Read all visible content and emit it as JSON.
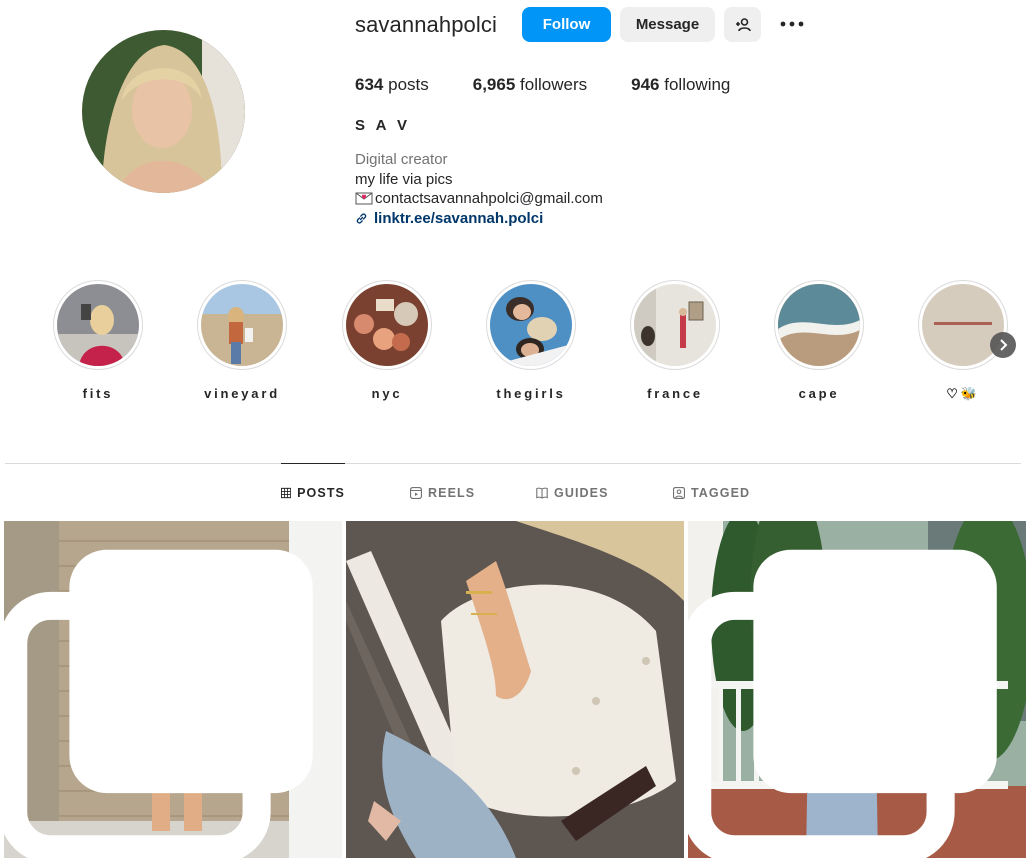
{
  "profile": {
    "username": "savannahpolci",
    "follow_label": "Follow",
    "message_label": "Message",
    "add_user_icon": "person-add-icon",
    "more_icon": "more-dots-icon",
    "posts_count": "634",
    "posts_label": "posts",
    "followers_count": "6,965",
    "followers_label": "followers",
    "following_count": "946",
    "following_label": "following",
    "full_name": "S A V",
    "category": "Digital creator",
    "bio_line": "my life via pics",
    "email": "contactsavannahpolci@gmail.com",
    "link": "linktr.ee/savannah.polci"
  },
  "highlights": [
    {
      "label": "fits"
    },
    {
      "label": "vineyard"
    },
    {
      "label": "nyc"
    },
    {
      "label": "thegirls"
    },
    {
      "label": "france"
    },
    {
      "label": "cape"
    },
    {
      "label": "♡🐝"
    }
  ],
  "tabs": [
    {
      "label": "POSTS",
      "icon": "grid-icon",
      "active": true
    },
    {
      "label": "REELS",
      "icon": "reels-icon",
      "active": false
    },
    {
      "label": "GUIDES",
      "icon": "guides-icon",
      "active": false
    },
    {
      "label": "TAGGED",
      "icon": "tagged-icon",
      "active": false
    }
  ],
  "colors": {
    "accent": "#0095f6",
    "link": "#00376b",
    "secondary_text": "#737373",
    "border": "#dbdbdb"
  }
}
